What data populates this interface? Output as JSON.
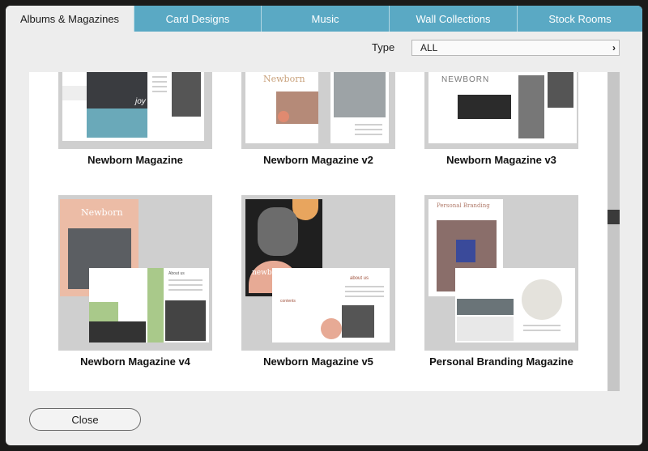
{
  "tabs": [
    {
      "label": "Albums & Magazines",
      "active": true
    },
    {
      "label": "Card Designs"
    },
    {
      "label": "Music"
    },
    {
      "label": "Wall Collections"
    },
    {
      "label": "Stock Rooms"
    }
  ],
  "filter": {
    "label": "Type",
    "value": "ALL"
  },
  "templates": [
    {
      "title": "Newborn Magazine",
      "thumb_text": [
        "joy"
      ]
    },
    {
      "title": "Newborn Magazine v2",
      "thumb_text": [
        "Newborn"
      ]
    },
    {
      "title": "Newborn Magazine v3",
      "thumb_text": [
        "NEWBORN"
      ]
    },
    {
      "title": "Newborn Magazine v4",
      "thumb_text": [
        "Newborn",
        "About us"
      ]
    },
    {
      "title": "Newborn Magazine v5",
      "thumb_text": [
        "newborn",
        "about us",
        "contents"
      ]
    },
    {
      "title": "Personal Branding Magazine",
      "thumb_text": [
        "Personal Branding"
      ]
    }
  ],
  "close_label": "Close",
  "colors": {
    "tab_bg": "#5aa9c4",
    "thumb_bg": "#cfcfcf",
    "accent_peach": "#e9b9a3",
    "accent_green": "#a9c98a",
    "accent_orange": "#e8a55e"
  }
}
